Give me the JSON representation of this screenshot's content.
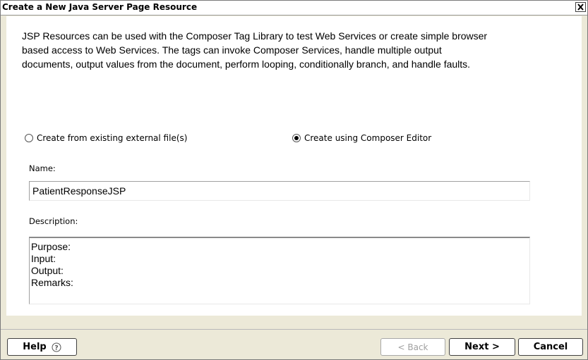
{
  "window": {
    "title": "Create a New Java Server Page Resource"
  },
  "intro": {
    "line1": "JSP Resources can be used with the Composer Tag Library to test Web Services or create simple browser",
    "line2": "based access to Web Services.  The tags can invoke Composer Services, handle multiple output",
    "line3": "documents, output values from the document, perform looping, conditionally branch, and handle faults."
  },
  "options": {
    "external": {
      "label": "Create from existing external file(s)",
      "selected": false
    },
    "editor": {
      "label": "Create using Composer Editor",
      "selected": true
    }
  },
  "name": {
    "label": "Name:",
    "value": "PatientResponseJSP"
  },
  "description": {
    "label": "Description:",
    "lines": [
      "Purpose:",
      "Input:",
      "Output:",
      "Remarks:"
    ]
  },
  "buttons": {
    "help": "Help",
    "back": "< Back",
    "next": "Next >",
    "cancel": "Cancel"
  }
}
